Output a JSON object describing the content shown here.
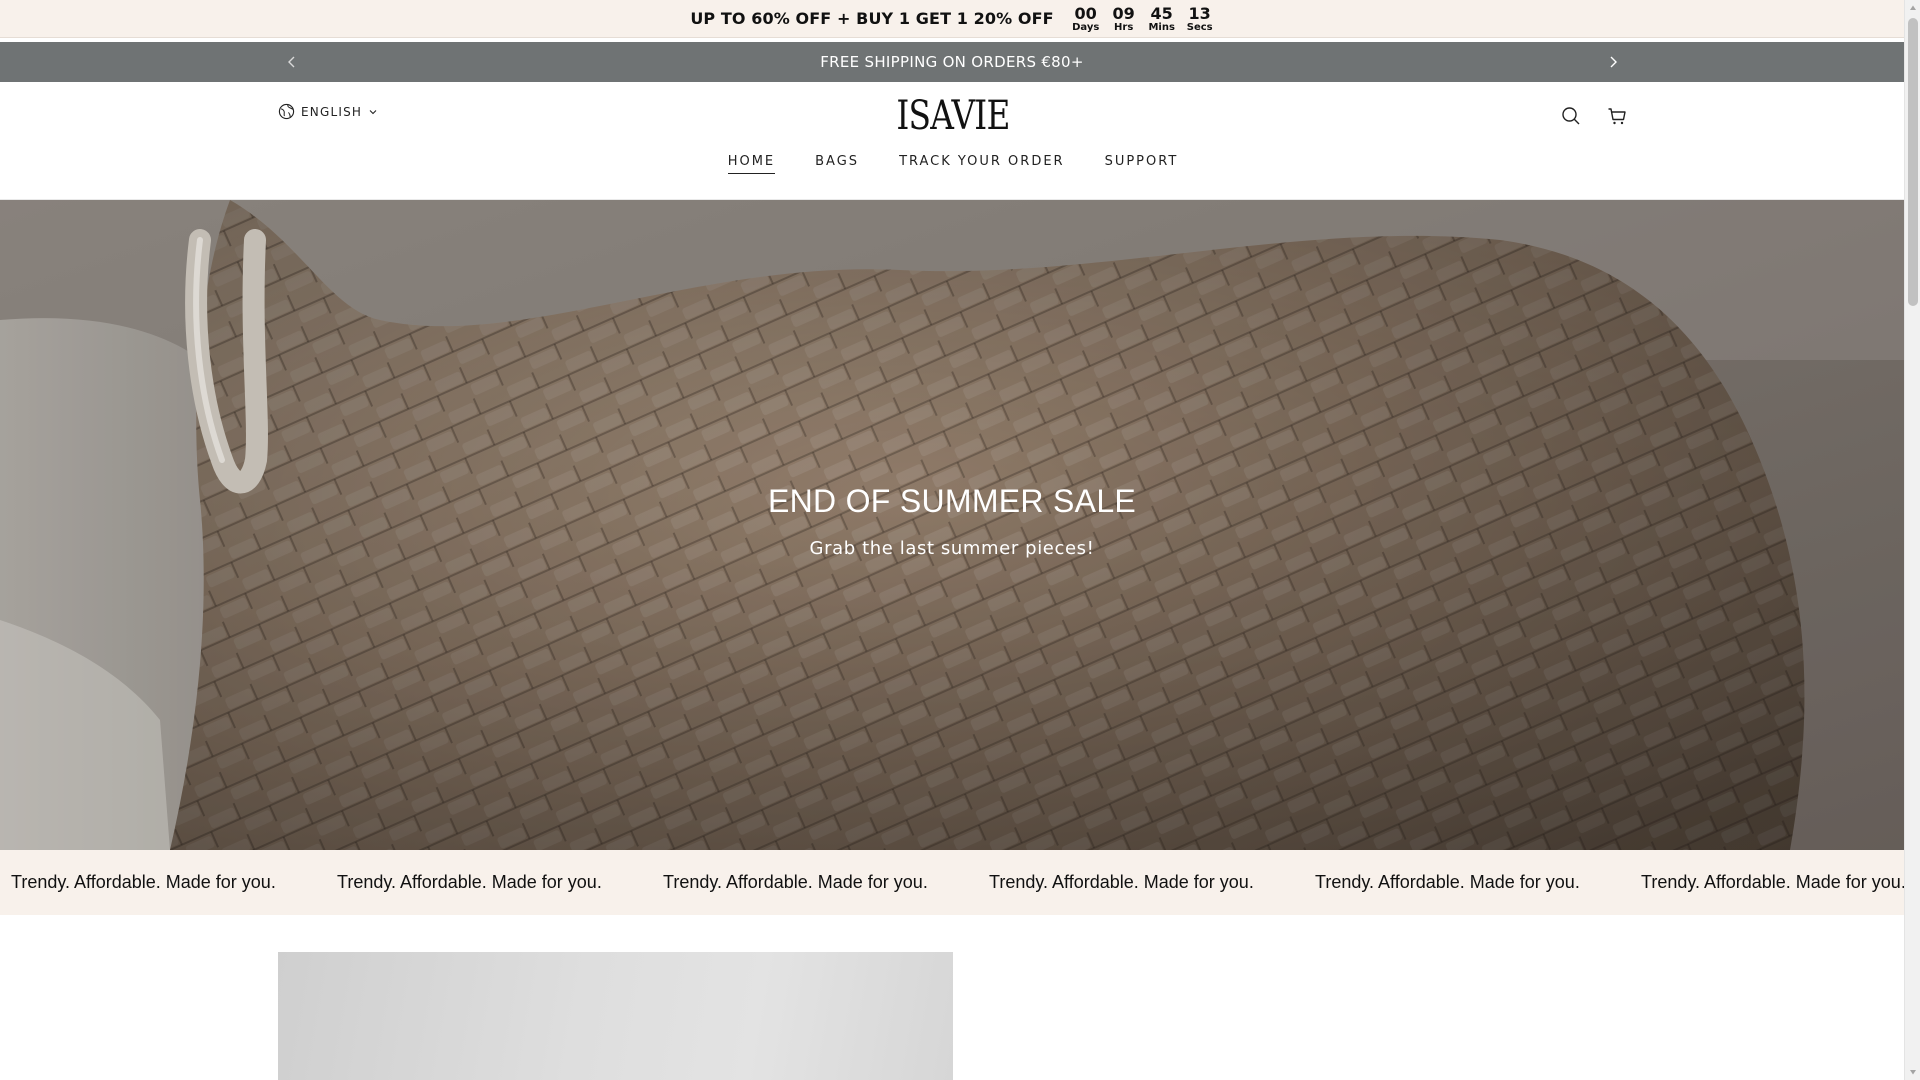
{
  "countdown": {
    "promo_text": "UP TO 60% OFF + BUY 1 GET 1 20% OFF",
    "units": [
      {
        "value": "00",
        "label": "Days"
      },
      {
        "value": "09",
        "label": "Hrs"
      },
      {
        "value": "45",
        "label": "Mins"
      },
      {
        "value": "13",
        "label": "Secs"
      }
    ]
  },
  "announcement": {
    "text": "FREE SHIPPING ON ORDERS €80+",
    "prev_icon": "chevron-left-icon",
    "next_icon": "chevron-right-icon"
  },
  "header": {
    "language": "ENGLISH",
    "language_icon": "globe-icon",
    "logo_text": "ISAVIE",
    "search_icon": "search-icon",
    "cart_icon": "cart-icon",
    "nav": [
      {
        "label": "HOME",
        "active": true
      },
      {
        "label": "BAGS",
        "active": false
      },
      {
        "label": "TRACK YOUR ORDER",
        "active": false
      },
      {
        "label": "SUPPORT",
        "active": false
      }
    ]
  },
  "hero": {
    "title": "END OF SUMMER SALE",
    "subtitle": "Grab the last summer pieces!"
  },
  "marquee": {
    "items": [
      "Trendy. Affordable. Made for you.",
      "Trendy. Affordable. Made for you.",
      "Trendy. Affordable. Made for you.",
      "Trendy. Affordable. Made for you.",
      "Trendy. Affordable. Made for you.",
      "Trendy. Affordable. Made for you."
    ]
  },
  "colors": {
    "countdown_bg": "#f8f1eb",
    "announcement_bg": "#6f7374",
    "marquee_bg": "#f8f1eb",
    "text": "#111111"
  }
}
